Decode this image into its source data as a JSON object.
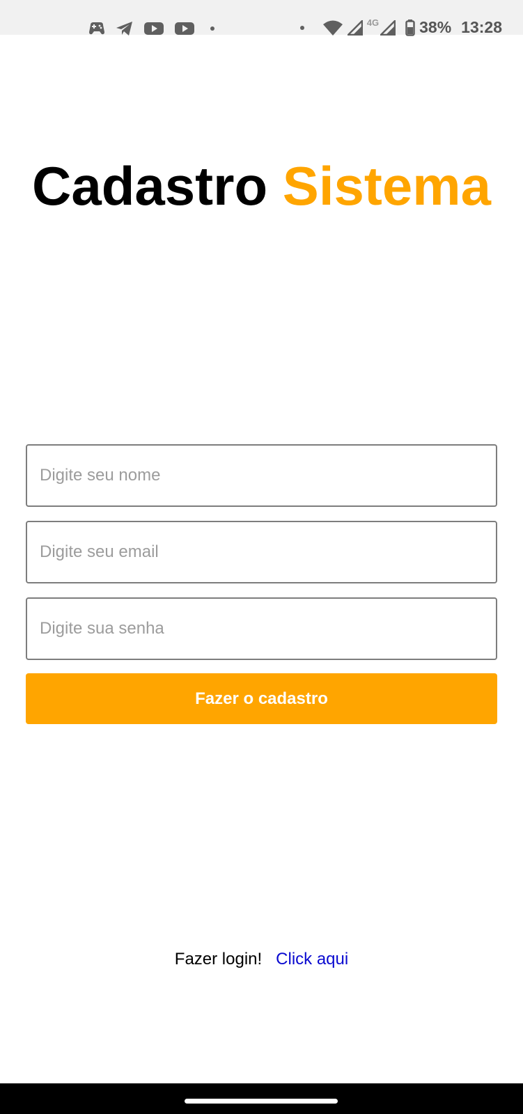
{
  "status_bar": {
    "battery": "38%",
    "time": "13:28",
    "network": "4G",
    "icons": [
      "game-controller-icon",
      "telegram-icon",
      "youtube-icon",
      "youtube-icon",
      "dot-icon",
      "dot-icon",
      "wifi-icon",
      "signal-icon",
      "signal-icon",
      "battery-icon"
    ]
  },
  "header": {
    "title_part1": "Cadastro",
    "title_part2": "Sistema"
  },
  "form": {
    "name_placeholder": "Digite seu nome",
    "email_placeholder": "Digite seu email",
    "password_placeholder": "Digite sua senha",
    "submit_label": "Fazer o cadastro"
  },
  "footer": {
    "login_prompt": "Fazer login!",
    "login_link": "Click aqui"
  },
  "colors": {
    "accent": "#ffa500",
    "link": "#0a0ad0",
    "status_bar_bg": "#f1f1f1"
  }
}
